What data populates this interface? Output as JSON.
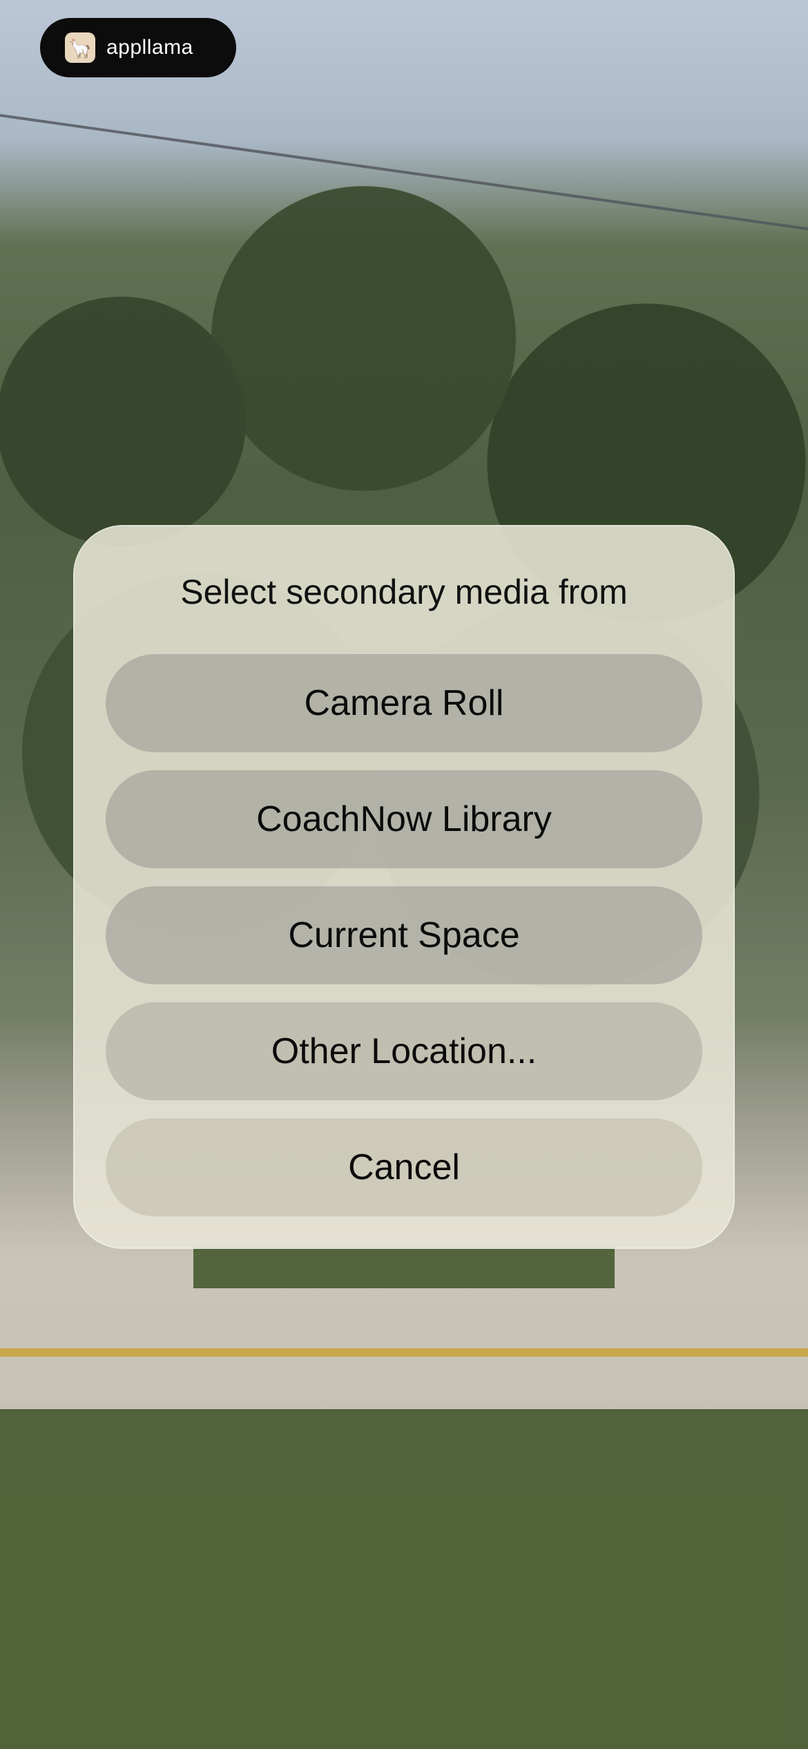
{
  "app": {
    "brand": "appllama"
  },
  "dialog": {
    "title": "Select secondary media from",
    "options": [
      {
        "label": "Camera Roll"
      },
      {
        "label": "CoachNow Library"
      },
      {
        "label": "Current Space"
      },
      {
        "label": "Other Location..."
      },
      {
        "label": "Cancel"
      }
    ]
  },
  "icons": {
    "brand_logo": "llama-icon"
  }
}
